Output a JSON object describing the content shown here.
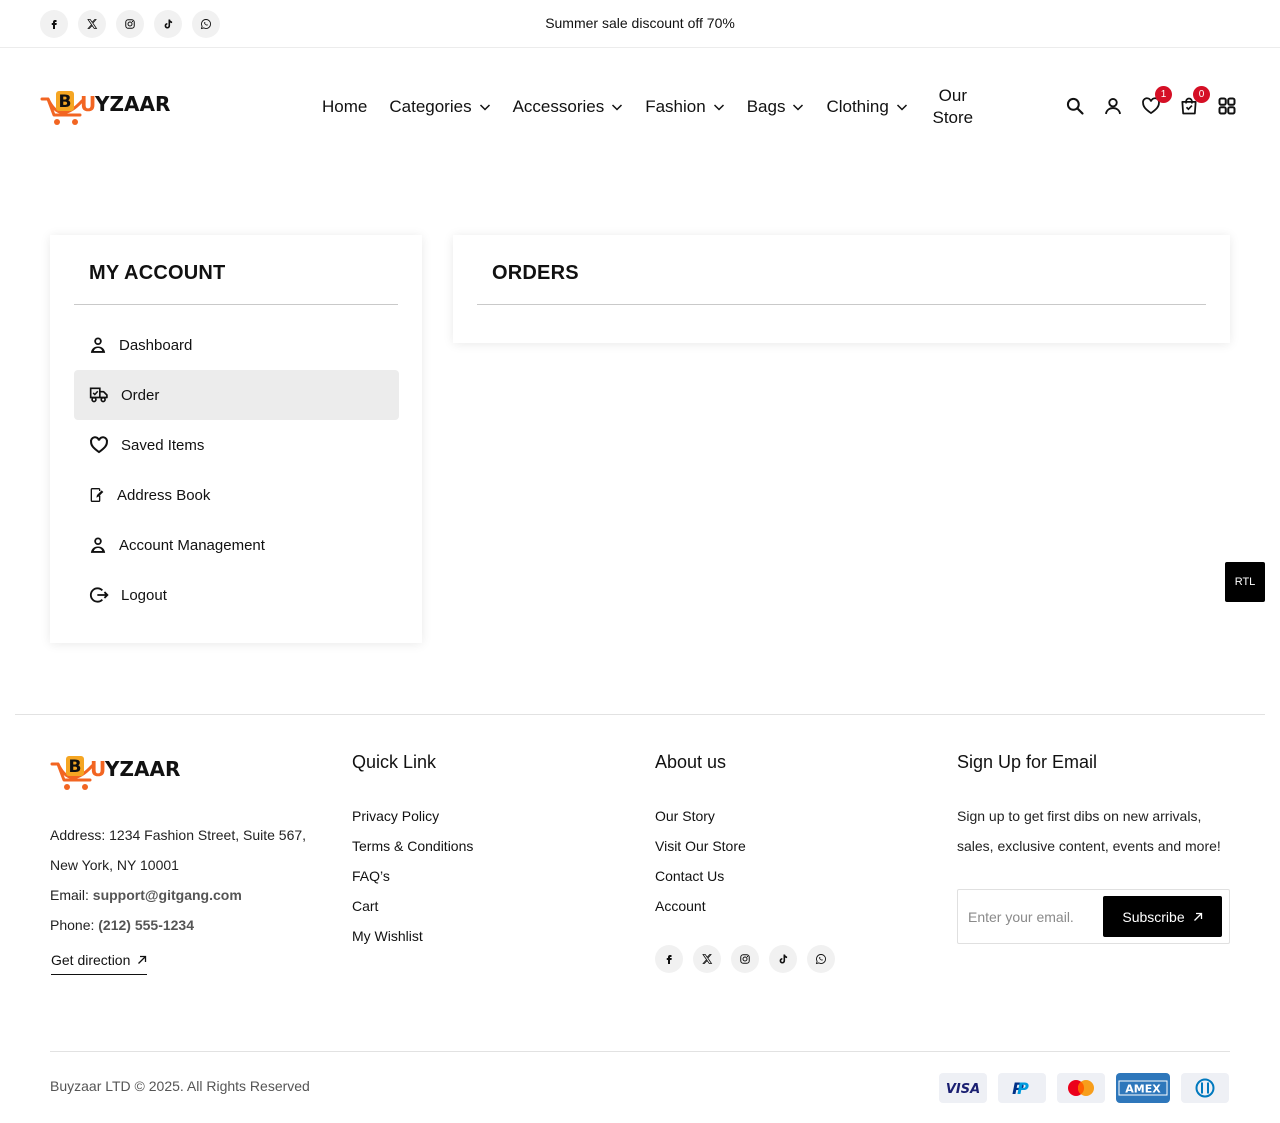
{
  "topbar": {
    "promo": "Summer sale discount off 70%",
    "socials": [
      "facebook-icon",
      "x-twitter-icon",
      "instagram-icon",
      "tiktok-icon",
      "whatsapp-icon"
    ]
  },
  "header": {
    "logo_text": "BUYZAAR",
    "nav": [
      {
        "label": "Home",
        "has_dropdown": false
      },
      {
        "label": "Categories",
        "has_dropdown": true
      },
      {
        "label": "Accessories",
        "has_dropdown": true
      },
      {
        "label": "Fashion",
        "has_dropdown": true
      },
      {
        "label": "Bags",
        "has_dropdown": true
      },
      {
        "label": "Clothing",
        "has_dropdown": true
      }
    ],
    "store_line1": "Our",
    "store_line2": "Store",
    "wishlist_count": "1",
    "cart_count": "0"
  },
  "account": {
    "title": "MY ACCOUNT",
    "menu": [
      {
        "label": "Dashboard",
        "icon": "user-icon",
        "active": false
      },
      {
        "label": "Order",
        "icon": "delivery-truck-icon",
        "active": true
      },
      {
        "label": "Saved Items",
        "icon": "heart-icon",
        "active": false
      },
      {
        "label": "Address Book",
        "icon": "edit-note-icon",
        "active": false
      },
      {
        "label": "Account Management",
        "icon": "user-icon",
        "active": false
      },
      {
        "label": "Logout",
        "icon": "logout-icon",
        "active": false
      }
    ]
  },
  "orders": {
    "title": "ORDERS"
  },
  "rtl": "RTL",
  "footer": {
    "address": "Address: 1234 Fashion Street, Suite 567, New York, NY 10001",
    "email_label": "Email:",
    "email": "support@gitgang.com",
    "phone_label": "Phone:",
    "phone": "(212) 555-1234",
    "get_direction": "Get direction",
    "quick_link": {
      "title": "Quick Link",
      "links": [
        "Privacy Policy",
        "Terms & Conditions",
        "FAQ’s",
        "Cart",
        "My Wishlist"
      ]
    },
    "about": {
      "title": "About us",
      "links": [
        "Our Story",
        "Visit Our Store",
        "Contact Us",
        "Account"
      ]
    },
    "signup": {
      "title": "Sign Up for Email",
      "text": "Sign up to get first dibs on new arrivals, sales, exclusive content, events and more!",
      "placeholder": "Enter your email.",
      "button": "Subscribe"
    },
    "copyright": "Buyzaar LTD © 2025. All Rights Reserved",
    "payments": [
      "VISA",
      "PayPal",
      "Mastercard",
      "AMEX",
      "Diners Club"
    ]
  },
  "colors": {
    "accent_orange": "#f26522",
    "badge_red": "#d50f25",
    "active_bg": "#ececec"
  }
}
